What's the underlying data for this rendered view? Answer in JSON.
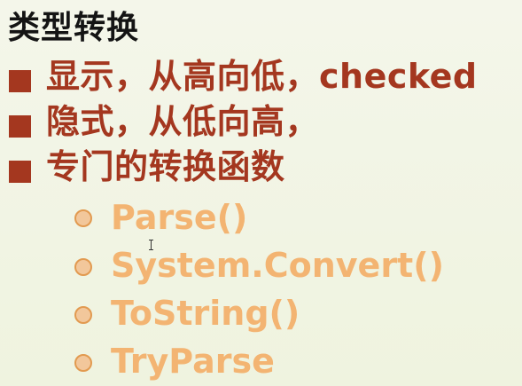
{
  "title": "类型转换",
  "bullets": [
    {
      "text": "显示，从高向低，checked"
    },
    {
      "text": "隐式，从低向高，"
    },
    {
      "text": "专门的转换函数"
    }
  ],
  "sub_items": [
    {
      "text": "Parse()"
    },
    {
      "text": "System.Convert()"
    },
    {
      "text": "ToString()"
    },
    {
      "text": "TryParse"
    }
  ],
  "colors": {
    "background": "#f1f4e4",
    "title": "#141414",
    "bullet": "#a4371f",
    "sub_text": "#f3b472",
    "sub_dot": "#e29a50"
  },
  "icons": {
    "bullet_marker": "square-bullet-icon",
    "sub_marker": "circle-bullet-icon",
    "cursor": "text-cursor-icon"
  }
}
